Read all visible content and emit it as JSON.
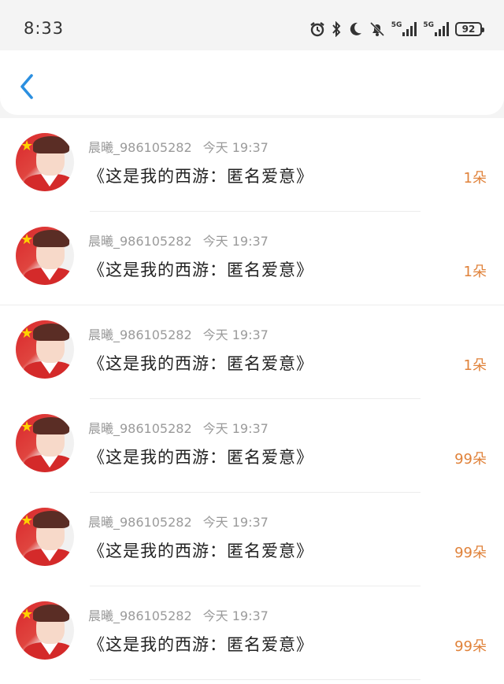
{
  "status_bar": {
    "time": "8:33",
    "network_1": "5G",
    "network_2": "5G",
    "battery": "92"
  },
  "header": {
    "back_icon": "chevron-left-icon",
    "accent": "#2b8fe0"
  },
  "list": {
    "items": [
      {
        "user": "晨曦_986105282",
        "time": "今天 19:37",
        "title": "《这是我的西游：匿名爱意》",
        "count": "1朵"
      },
      {
        "user": "晨曦_986105282",
        "time": "今天 19:37",
        "title": "《这是我的西游：匿名爱意》",
        "count": "1朵"
      },
      {
        "user": "晨曦_986105282",
        "time": "今天 19:37",
        "title": "《这是我的西游：匿名爱意》",
        "count": "1朵"
      },
      {
        "user": "晨曦_986105282",
        "time": "今天 19:37",
        "title": "《这是我的西游：匿名爱意》",
        "count": "99朵"
      },
      {
        "user": "晨曦_986105282",
        "time": "今天 19:37",
        "title": "《这是我的西游：匿名爱意》",
        "count": "99朵"
      },
      {
        "user": "晨曦_986105282",
        "time": "今天 19:37",
        "title": "《这是我的西游：匿名爱意》",
        "count": "99朵"
      }
    ]
  },
  "colors": {
    "count_color": "#e0823a",
    "meta_color": "#9a9a9a"
  }
}
